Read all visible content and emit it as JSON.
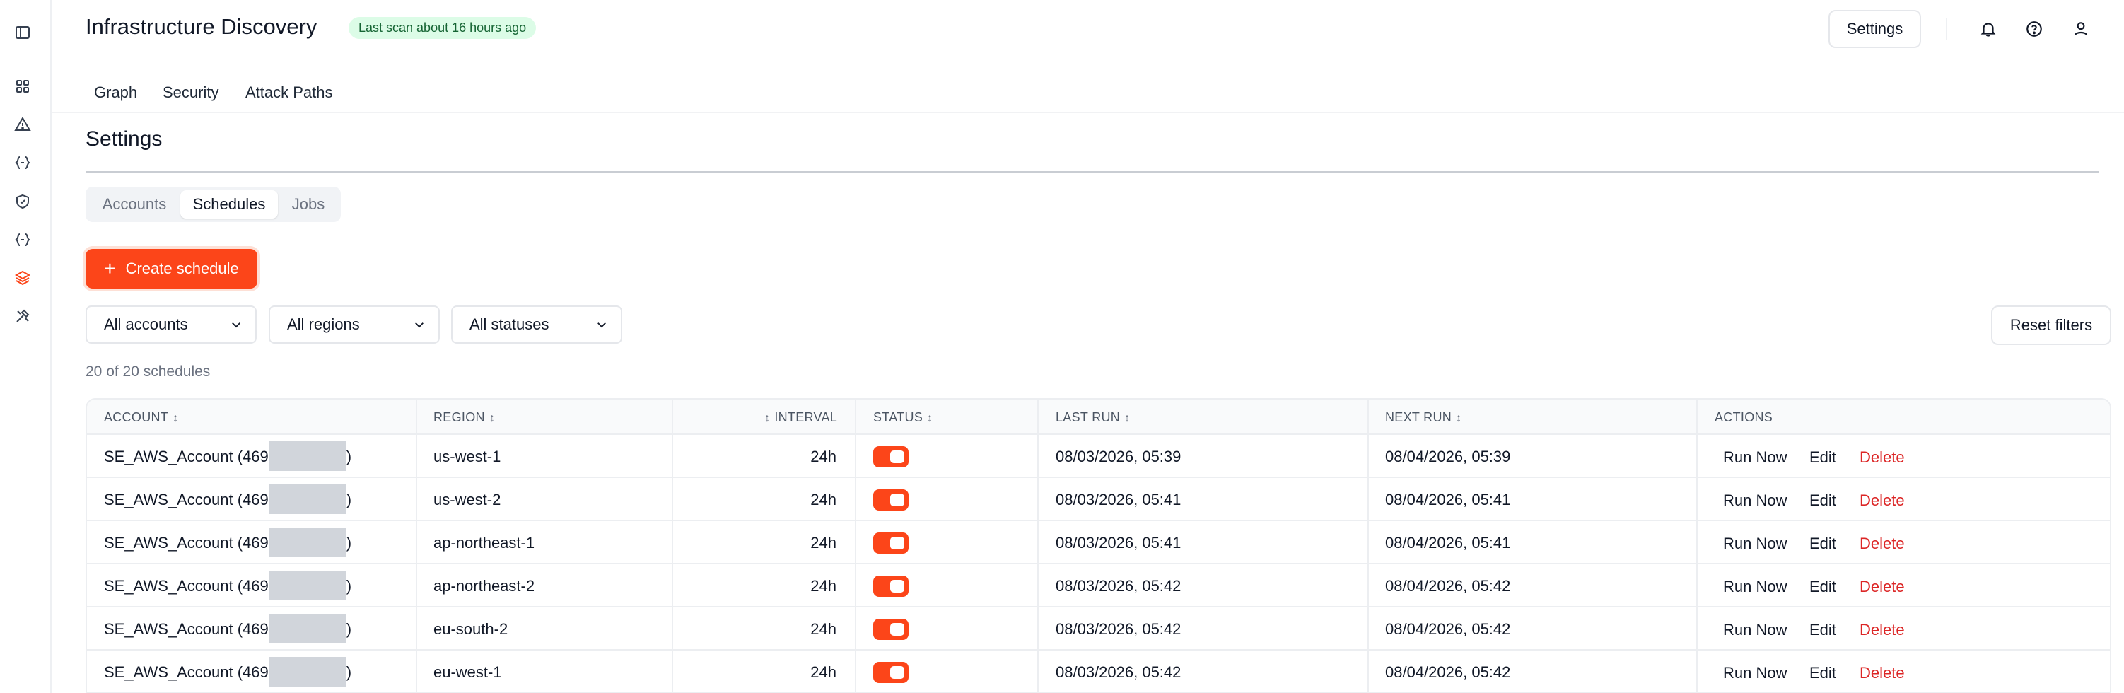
{
  "app": {
    "title": "Infrastructure Discovery",
    "scan_badge": "Last scan about 16 hours ago",
    "settings_button": "Settings"
  },
  "sidebar_icons": [
    "panel-toggle-icon",
    "dashboard-grid-icon",
    "warning-triangle-icon",
    "code-braces-icon",
    "shield-icon",
    "code-braces-icon",
    "layers-icon",
    "tools-icon"
  ],
  "header_icons": [
    "bell-icon",
    "help-circle-icon",
    "user-icon"
  ],
  "top_tabs": [
    "Graph",
    "Security",
    "Attack Paths"
  ],
  "page": {
    "heading": "Settings",
    "segments": [
      "Accounts",
      "Schedules",
      "Jobs"
    ],
    "active_segment": "Schedules",
    "create_button": "Create schedule",
    "filters": [
      "All accounts",
      "All regions",
      "All statuses"
    ],
    "reset_button": "Reset filters",
    "count_text": "20 of 20 schedules"
  },
  "table": {
    "columns": [
      "ACCOUNT",
      "REGION",
      "INTERVAL",
      "STATUS",
      "LAST RUN",
      "NEXT RUN",
      "ACTIONS"
    ],
    "actions": [
      "Run Now",
      "Edit",
      "Delete"
    ],
    "rows": [
      {
        "account_prefix": "SE_AWS_Account (469",
        "account_suffix": ")",
        "region": "us-west-1",
        "interval": "24h",
        "enabled": true,
        "last_run": "08/03/2026, 05:39",
        "next_run": "08/04/2026, 05:39"
      },
      {
        "account_prefix": "SE_AWS_Account (469",
        "account_suffix": ")",
        "region": "us-west-2",
        "interval": "24h",
        "enabled": true,
        "last_run": "08/03/2026, 05:41",
        "next_run": "08/04/2026, 05:41"
      },
      {
        "account_prefix": "SE_AWS_Account (469",
        "account_suffix": ")",
        "region": "ap-northeast-1",
        "interval": "24h",
        "enabled": true,
        "last_run": "08/03/2026, 05:41",
        "next_run": "08/04/2026, 05:41"
      },
      {
        "account_prefix": "SE_AWS_Account (469",
        "account_suffix": ")",
        "region": "ap-northeast-2",
        "interval": "24h",
        "enabled": true,
        "last_run": "08/03/2026, 05:42",
        "next_run": "08/04/2026, 05:42"
      },
      {
        "account_prefix": "SE_AWS_Account (469",
        "account_suffix": ")",
        "region": "eu-south-2",
        "interval": "24h",
        "enabled": true,
        "last_run": "08/03/2026, 05:42",
        "next_run": "08/04/2026, 05:42"
      },
      {
        "account_prefix": "SE_AWS_Account (469",
        "account_suffix": ")",
        "region": "eu-west-1",
        "interval": "24h",
        "enabled": true,
        "last_run": "08/03/2026, 05:42",
        "next_run": "08/04/2026, 05:42"
      }
    ]
  },
  "colors": {
    "accent": "#fc4519",
    "danger": "#dc2626",
    "badge_bg": "#dcfce7",
    "badge_text": "#166534"
  }
}
